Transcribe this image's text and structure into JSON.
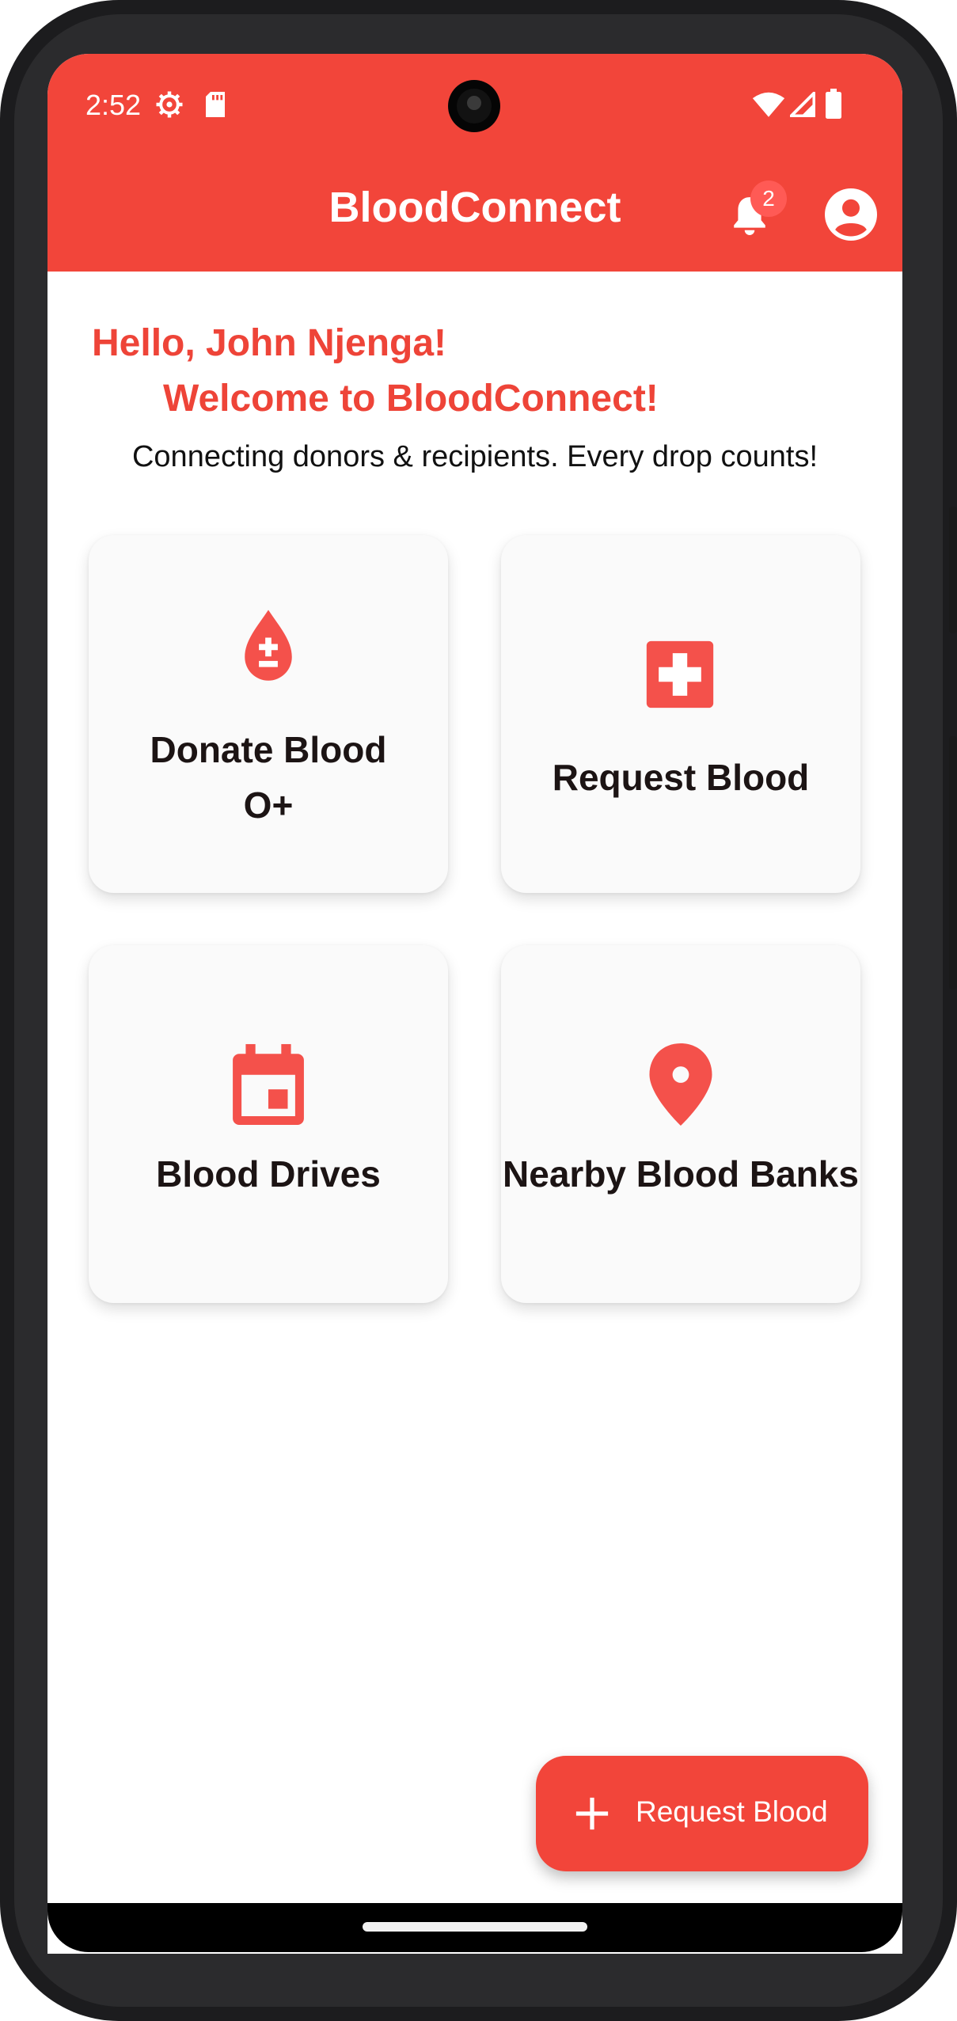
{
  "status_bar": {
    "time": "2:52",
    "icons": [
      "settings-icon",
      "sd-card-icon",
      "wifi-icon",
      "signal-icon",
      "battery-icon"
    ]
  },
  "app_bar": {
    "title": "BloodConnect",
    "notification_count": "2",
    "icons": [
      "bell-icon",
      "account-circle-icon"
    ]
  },
  "greeting": {
    "hello": "Hello, John Njenga!",
    "welcome": "Welcome to BloodConnect!",
    "tagline": "Connecting donors & recipients. Every drop counts!"
  },
  "cards": [
    {
      "label": "Donate Blood",
      "sublabel": "O+",
      "icon": "blood-drop-icon"
    },
    {
      "label": "Request Blood",
      "icon": "medical-cross-icon"
    },
    {
      "label": "Blood Drives",
      "icon": "calendar-icon"
    },
    {
      "label": "Nearby Blood Banks",
      "icon": "location-pin-icon"
    }
  ],
  "fab": {
    "label": "Request Blood",
    "icon": "plus-icon"
  },
  "colors": {
    "primary": "#f2453a",
    "icon": "#f4514b",
    "text": "#1c1414"
  }
}
